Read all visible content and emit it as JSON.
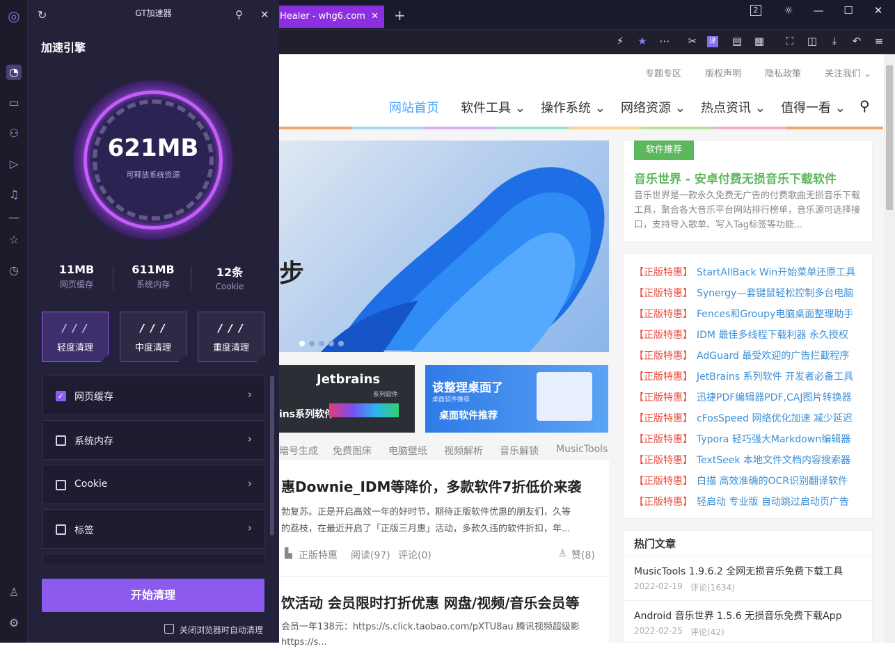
{
  "browser": {
    "tab_title": "Healer - whg6.com",
    "tab_close": "✕",
    "new_tab": "+",
    "window_count": "2",
    "toolbar_partial": "/"
  },
  "panel": {
    "title": "GT加速器",
    "heading": "加速引擎",
    "gauge_value": "621MB",
    "gauge_label": "可释放系统资源",
    "stats": [
      {
        "value": "11MB",
        "label": "网页缓存"
      },
      {
        "value": "611MB",
        "label": "系统内存"
      },
      {
        "value": "12条",
        "label": "Cookie"
      }
    ],
    "modes": [
      {
        "bars": "/ / /",
        "label": "轻度清理",
        "active": true
      },
      {
        "bars": "/ / /",
        "label": "中度清理",
        "active": false
      },
      {
        "bars": "/ / /",
        "label": "重度清理",
        "active": false
      }
    ],
    "items": [
      {
        "label": "网页缓存",
        "checked": true
      },
      {
        "label": "系统内存",
        "checked": false
      },
      {
        "label": "Cookie",
        "checked": false
      },
      {
        "label": "标签",
        "checked": false
      }
    ],
    "start_button": "开始清理",
    "auto_clean_label": "关闭浏览器时自动清理"
  },
  "site": {
    "top_links": [
      "专题专区",
      "版权声明",
      "隐私政策",
      "关注我们 ⌄"
    ],
    "nav": [
      "网站首页",
      "软件工具 ⌄",
      "操作系统 ⌄",
      "网络资源 ⌄",
      "热点资讯 ⌄",
      "值得一看 ⌄"
    ],
    "hero_text": "步",
    "thumb1_title": "Jetbrains",
    "thumb1_sub": "系列软件",
    "thumb1_caption": "ins系列软件",
    "thumb2_title": "该整理桌面了",
    "thumb2_sub": "桌面软件推荐",
    "thumb2_caption": "桌面软件推荐",
    "tags": [
      "暗号生成",
      "免费图床",
      "电脑壁纸",
      "视频解析",
      "音乐解锁",
      "MusicTools"
    ],
    "post1": {
      "title": "惠Downie_IDM等降价，多款软件7折低价来袭",
      "excerpt1": "勃复苏。正是开启高效一年的好时节，期待正版软件优惠的朋友们，久等",
      "excerpt2": "的荔枝，在最近开启了「正版三月惠」活动，多款久违的软件折扣，年...",
      "category": "正版特惠",
      "reads": "阅读(97)",
      "comments": "评论(0)",
      "likes": "赞(8)"
    },
    "post2": {
      "title": "饮活动 会员限时打折优惠 网盘/视频/音乐会员等",
      "excerpt1": "会员一年138元：https://s.click.taobao.com/pXTU8au 腾讯视频超级影",
      "excerpt2": "https://s..."
    },
    "featured": {
      "badge": "软件推荐",
      "title": "音乐世界 - 安卓付费无损音乐下载软件",
      "desc": "音乐世界是一款永久免费无广告的付费歌曲无损音乐下载工具，聚合各大音乐平台网站排行榜单，音乐源可选择接口，支持导入歌单、写入Tag标签等功能..."
    },
    "promos": [
      {
        "tag": "【正版特惠】",
        "text": "StartAllBack Win开始菜单还原工具"
      },
      {
        "tag": "【正版特惠】",
        "text": "Synergy—套键鼠轻松控制多台电脑"
      },
      {
        "tag": "【正版特惠】",
        "text": "Fences和Groupy电脑桌面整理助手"
      },
      {
        "tag": "【正版特惠】",
        "text": "IDM 最佳多线程下载利器 永久授权"
      },
      {
        "tag": "【正版特惠】",
        "text": "AdGuard 最受欢迎的广告拦截程序"
      },
      {
        "tag": "【正版特惠】",
        "text": "JetBrains 系列软件 开发者必备工具"
      },
      {
        "tag": "【正版特惠】",
        "text": "迅捷PDF编辑器PDF,CAJ图片转换器"
      },
      {
        "tag": "【正版特惠】",
        "text": "cFosSpeed 网络优化加速 减少延迟"
      },
      {
        "tag": "【正版特惠】",
        "text": "Typora 轻巧强大Markdown编辑器"
      },
      {
        "tag": "【正版特惠】",
        "text": "TextSeek 本地文件文档内容搜索器"
      },
      {
        "tag": "【正版特惠】",
        "text": "白描 高效准确的OCR识别翻译软件"
      },
      {
        "tag": "【正版特惠】",
        "text": "轻启动 专业版 自动跳过启动页广告"
      }
    ],
    "hot_title": "热门文章",
    "articles": [
      {
        "title": "MusicTools 1.9.6.2 全网无损音乐免费下载工具",
        "date": "2022-02-19",
        "comments": "评论(1634)"
      },
      {
        "title": "Android 音乐世界 1.5.6 无损音乐免费下载App",
        "date": "2022-02-25",
        "comments": "评论(42)"
      }
    ]
  }
}
